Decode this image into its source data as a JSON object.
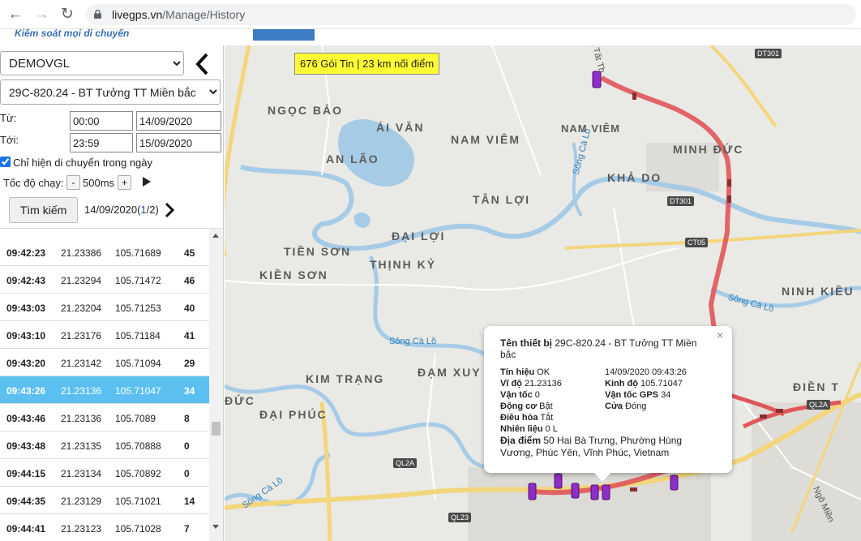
{
  "browser": {
    "url_host": "livegps.vn",
    "url_path": "/Manage/History"
  },
  "header": {
    "tagline": "Kiểm soát mọi di chuyển"
  },
  "panel": {
    "account_select": "DEMOVGL",
    "vehicle_select": "29C-820.24 - BT Tưởng TT Miền bắc",
    "from_label": "Từ:",
    "to_label": "Tới:",
    "from_time": "00:00",
    "from_date": "14/09/2020",
    "to_time": "23:59",
    "to_date": "15/09/2020",
    "only_moving_label": "Chỉ hiện di chuyển trong ngày",
    "only_moving_checked": true,
    "speed_label": "Tốc độ chạy:",
    "minus": "-",
    "speed_value": "500ms",
    "plus": "+",
    "search_label": "Tìm kiếm",
    "page_date": "14/09/2020(",
    "page_current": "1",
    "page_rest": "/2)"
  },
  "table": {
    "rows": [
      {
        "time": "09:42:23",
        "lat": "21.23386",
        "lng": "105.71689",
        "speed": "45"
      },
      {
        "time": "09:42:43",
        "lat": "21.23294",
        "lng": "105.71472",
        "speed": "46"
      },
      {
        "time": "09:43:03",
        "lat": "21.23204",
        "lng": "105.71253",
        "speed": "40"
      },
      {
        "time": "09:43:10",
        "lat": "21.23176",
        "lng": "105.71184",
        "speed": "41"
      },
      {
        "time": "09:43:20",
        "lat": "21.23142",
        "lng": "105.71094",
        "speed": "29"
      },
      {
        "time": "09:43:26",
        "lat": "21.23136",
        "lng": "105.71047",
        "speed": "34",
        "selected": true
      },
      {
        "time": "09:43:46",
        "lat": "21.23136",
        "lng": "105.7089",
        "speed": "8"
      },
      {
        "time": "09:43:48",
        "lat": "21.23135",
        "lng": "105.70888",
        "speed": "0"
      },
      {
        "time": "09:44:15",
        "lat": "21.23134",
        "lng": "105.70892",
        "speed": "0"
      },
      {
        "time": "09:44:35",
        "lat": "21.23129",
        "lng": "105.71021",
        "speed": "14"
      },
      {
        "time": "09:44:41",
        "lat": "21.23123",
        "lng": "105.71028",
        "speed": "7"
      }
    ]
  },
  "map": {
    "summary": "676 Gói Tin | 23 km nối điểm",
    "places": [
      "NGỌC BẢO",
      "ÁI VĂN",
      "AN LÃO",
      "NAM VIÊM",
      "NAM VIÊM",
      "MINH ĐỨC",
      "KHẢ DO",
      "TÂN LỢI",
      "ĐẠI LỢI",
      "TIỀN SƠN",
      "THỊNH KỶ",
      "KIỀN SƠN",
      "NINH KIỀU",
      "KIM TRẠNG",
      "ĐẠM XUY",
      "ĐỨC",
      "ĐẠI PHÚC",
      "ĐIỀN T"
    ],
    "roads": [
      "DT301",
      "DT301",
      "CT05",
      "QL2A",
      "QL2A",
      "QL23"
    ],
    "rivers": [
      "Sông Cà Lồ",
      "Sông Cà Lồ",
      "Sông Cà Lồ",
      "Sông Cà Lồ"
    ],
    "misc": [
      "n Tất Th",
      "Ngõ Miền"
    ]
  },
  "info": {
    "device_key": "Tên thiết bị",
    "device_val": "29C-820.24 - BT Tưởng TT Miền bắc",
    "signal_key": "Tín hiệu",
    "signal_val": "OK",
    "datetime": "14/09/2020 09:43:26",
    "lat_key": "Vĩ độ",
    "lat_val": "21.23136",
    "lng_key": "Kinh độ",
    "lng_val": "105.71047",
    "speed_key": "Vận tốc",
    "speed_val": "0",
    "gps_speed_key": "Vận tốc GPS",
    "gps_speed_val": "34",
    "engine_key": "Động cơ",
    "engine_val": "Bật",
    "door_key": "Cửa",
    "door_val": "Đóng",
    "ac_key": "Điều hòa",
    "ac_val": "Tắt",
    "fuel_key": "Nhiên liệu",
    "fuel_val": "0 L",
    "address_key": "Địa điểm",
    "address_val": "50 Hai Bà Trưng, Phường Hùng Vương, Phúc Yên, Vĩnh Phúc, Vietnam",
    "close": "×"
  }
}
